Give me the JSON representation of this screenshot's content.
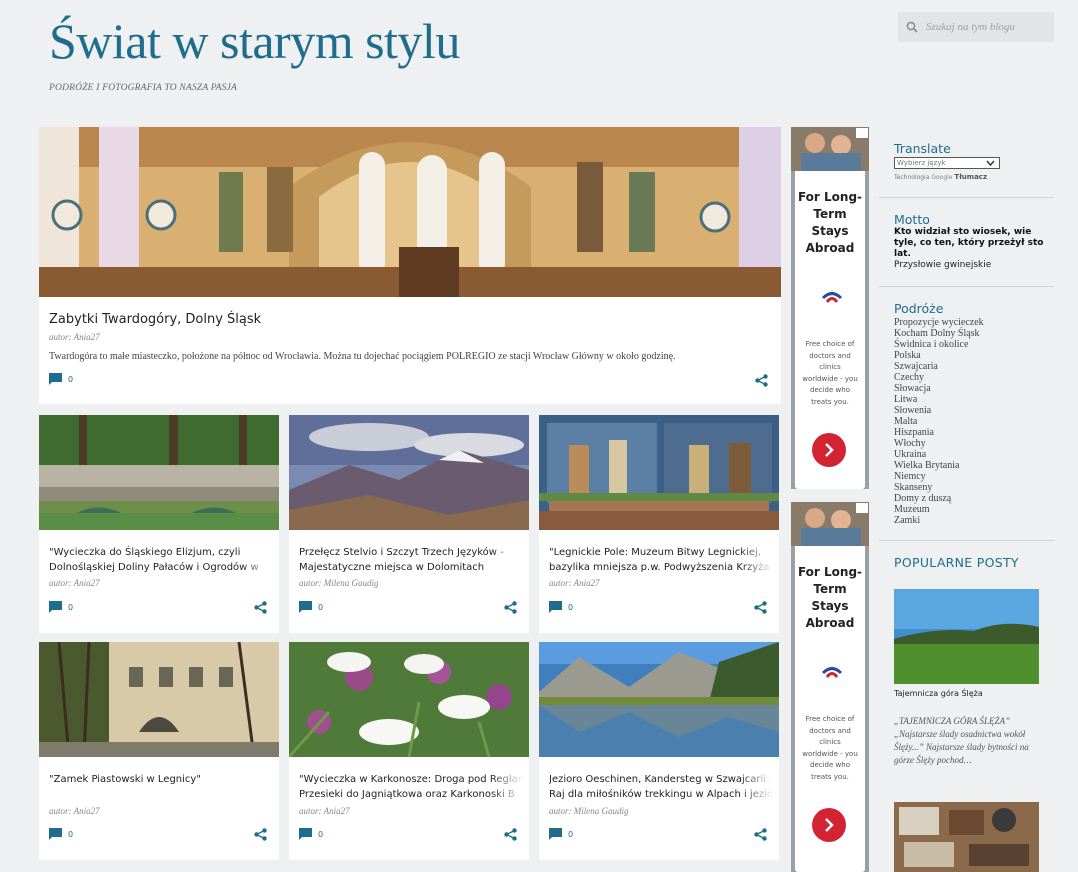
{
  "header": {
    "title": "Świat w starym stylu",
    "description": "PODRÓŻE I FOTOGRAFIA TO NASZA PASJA"
  },
  "search": {
    "placeholder": "Szukaj na tym blogu"
  },
  "featured": {
    "title": "Zabytki Twardogóry, Dolny Śląsk",
    "author": "autor: Ania27",
    "snippet": "Twardogóra to małe miasteczko, położone na północ od Wrocławia. Można tu dojechać pociągiem POLREGIO ze stacji Wrocław Główny w około godzinę.",
    "comments": "0"
  },
  "posts": [
    {
      "title_1": "\"Wycieczka do Śląskiego Elizjum, czyli",
      "title_2": "Dolnośląskiej Doliny Pałaców i Ogrodów w",
      "author": "autor: Ania27",
      "comments": "0"
    },
    {
      "title_1": "Przełęcz Stelvio i Szczyt Trzech Języków -",
      "title_2": "Majestatyczne miejsca w Dolomitach",
      "author": "autor: Milena Gaudig",
      "comments": "0"
    },
    {
      "title_1": "\"Legnickie Pole: Muzeum Bitwy Legnickiej,",
      "title_2": "bazylika mniejsza p.w. Podwyższenia Krzyża",
      "author": "autor: Ania27",
      "comments": "0"
    },
    {
      "title_1": "\"Zamek Piastowski w Legnicy\"",
      "title_2": "",
      "author": "autor: Ania27",
      "comments": "0"
    },
    {
      "title_1": "\"Wycieczka w Karkonosze: Droga pod Reglami z",
      "title_2": "Przesieki do Jagniątkowa oraz Karkonoski B",
      "author": "autor: Ania27",
      "comments": "0"
    },
    {
      "title_1": "Jezioro Oeschinen, Kandersteg w Szwajcarii:",
      "title_2": "Raj dla miłośników trekkingu w Alpach i jezio",
      "author": "autor: Milena Gaudig",
      "comments": "0"
    }
  ],
  "ads": [
    {
      "headline_1": "For Long-",
      "headline_2": "Term",
      "headline_3": "Stays",
      "headline_4": "Abroad",
      "text_1": "Free choice of",
      "text_2": "doctors and",
      "text_3": "clinics",
      "text_4": "worldwide - you",
      "text_5": "decide who",
      "text_6": "treats you."
    },
    {
      "headline_1": "For Long-",
      "headline_2": "Term",
      "headline_3": "Stays",
      "headline_4": "Abroad",
      "text_1": "Free choice of",
      "text_2": "doctors and",
      "text_3": "clinics",
      "text_4": "worldwide - you",
      "text_5": "decide who",
      "text_6": "treats you."
    }
  ],
  "sidebar": {
    "translate": {
      "heading": "Translate",
      "select_value": "Wybierz język",
      "powered_prefix": "Technologia",
      "powered_brand": "Google",
      "powered_suffix": "Tłumacz"
    },
    "motto": {
      "heading": "Motto",
      "text": "Kto widział sto wiosek, wie tyle, co ten, który przeżył sto lat.",
      "source": "Przysłowie gwinejskie"
    },
    "travel": {
      "heading": "Podróże",
      "links": [
        "Propozycje wycieczek",
        "Kocham Dolny Śląsk",
        "Świdnica i okolice",
        "Polska",
        "Szwajcaria",
        "Czechy",
        "Słowacja",
        "Litwa",
        "Słowenia",
        "Malta",
        "Hiszpania",
        "Włochy",
        "Ukraina",
        "Wielka Brytania",
        "Niemcy",
        "Skanseny",
        "Domy z duszą",
        "Muzeum",
        "Zamki"
      ]
    },
    "popular": {
      "heading": "POPULARNE POSTY",
      "post_title": "Tajemnicza góra Ślęża",
      "snippet": "„TAJEMNICZA GÓRA ŚLĘŻA” „Najstarsze ślady osadnictwa wokół Ślęży...” Najstarsze ślady bytności na górze Ślęży pochod…"
    }
  },
  "colors": {
    "accent": "#1e6d8c",
    "background": "#eef0f1",
    "ad_button": "#d32232"
  }
}
